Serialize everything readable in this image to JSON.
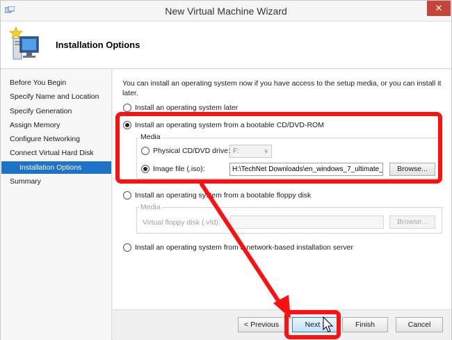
{
  "window": {
    "title": "New Virtual Machine Wizard",
    "close_symbol": "✕"
  },
  "header": {
    "title": "Installation Options",
    "icon": "virtual-machine-monitor-icon"
  },
  "sidebar": {
    "items": [
      {
        "label": "Before You Begin",
        "selected": false
      },
      {
        "label": "Specify Name and Location",
        "selected": false
      },
      {
        "label": "Specify Generation",
        "selected": false
      },
      {
        "label": "Assign Memory",
        "selected": false
      },
      {
        "label": "Configure Networking",
        "selected": false
      },
      {
        "label": "Connect Virtual Hard Disk",
        "selected": false
      },
      {
        "label": "Installation Options",
        "selected": true
      },
      {
        "label": "Summary",
        "selected": false
      }
    ]
  },
  "main": {
    "intro": "You can install an operating system now if you have access to the setup media, or you can install it later.",
    "options": {
      "later": {
        "label": "Install an operating system later",
        "checked": false
      },
      "cd": {
        "label": "Install an operating system from a bootable CD/DVD-ROM",
        "checked": true,
        "media_title": "Media",
        "physical_label": "Physical CD/DVD drive:",
        "physical_checked": false,
        "drive_value": "F:",
        "image_label": "Image file (.iso):",
        "image_checked": true,
        "image_value": "H:\\TechNet Downloads\\en_windows_7_ultimate_",
        "browse_label": "Browse..."
      },
      "floppy": {
        "label": "Install an operating system from a bootable floppy disk",
        "checked": false,
        "media_title": "Media",
        "vfd_label": "Virtual floppy disk (.vfd):",
        "vfd_value": "",
        "browse_label": "Browse..."
      },
      "network": {
        "label": "Install an operating system from a network-based installation server",
        "checked": false
      }
    }
  },
  "footer": {
    "previous_label": "< Previous",
    "next_label": "Next >",
    "finish_label": "Finish",
    "cancel_label": "Cancel"
  },
  "colors": {
    "selection": "#1e73c6",
    "annotation": "#ff1010"
  }
}
